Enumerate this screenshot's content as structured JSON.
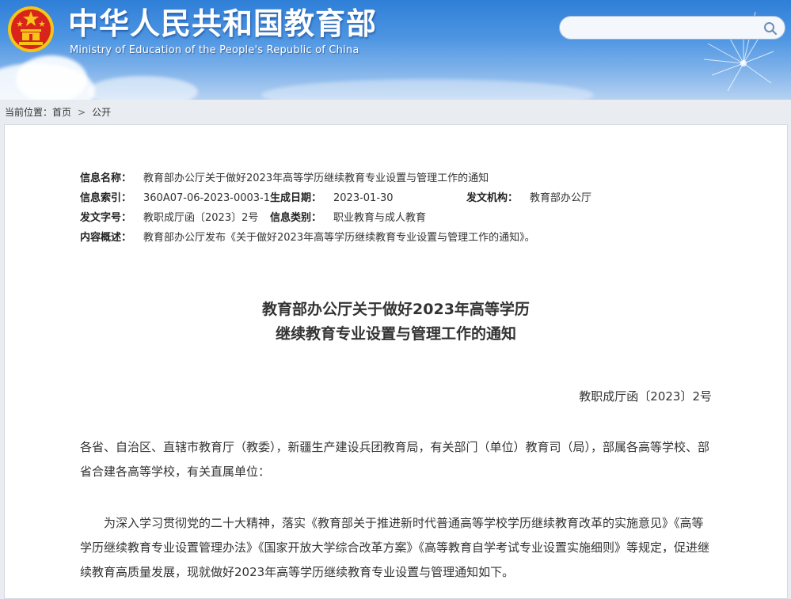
{
  "header": {
    "title": "中华人民共和国教育部",
    "subtitle": "Ministry of Education of the People's Republic of China",
    "search": {
      "placeholder": "",
      "icon": "search-icon"
    }
  },
  "breadcrumb": {
    "prefix": "当前位置：",
    "items": [
      "首页",
      "公开"
    ],
    "separator": ">"
  },
  "meta": {
    "name_label": "信息名称：",
    "name_value": "教育部办公厅关于做好2023年高等学历继续教育专业设置与管理工作的通知",
    "index_label": "信息索引：",
    "index_value": "360A07-06-2023-0003-1",
    "date_label": "生成日期：",
    "date_value": "2023-01-30",
    "issuer_label": "发文机构：",
    "issuer_value": "教育部办公厅",
    "docno_label": "发文字号：",
    "docno_value": "教职成厅函〔2023〕2号",
    "category_label": "信息类别：",
    "category_value": "职业教育与成人教育",
    "summary_label": "内容概述：",
    "summary_value": "教育部办公厅发布《关于做好2023年高等学历继续教育专业设置与管理工作的通知》。"
  },
  "document": {
    "title_line1": "教育部办公厅关于做好2023年高等学历",
    "title_line2": "继续教育专业设置与管理工作的通知",
    "number": "教职成厅函〔2023〕2号",
    "para1": "各省、自治区、直辖市教育厅（教委），新疆生产建设兵团教育局，有关部门（单位）教育司（局），部属各高等学校、部省合建各高等学校，有关直属单位：",
    "para2": "为深入学习贯彻党的二十大精神，落实《教育部关于推进新时代普通高等学校学历继续教育改革的实施意见》《高等学历继续教育专业设置管理办法》《国家开放大学综合改革方案》《高等教育自学考试专业设置实施细则》等规定，促进继续教育高质量发展，现就做好2023年高等学历继续教育专业设置与管理通知如下。"
  },
  "colors": {
    "banner_top": "#2f7fd8",
    "banner_bottom": "#b6d2f2",
    "emblem_red": "#d9241c",
    "emblem_gold": "#f5c518",
    "text": "#333333"
  }
}
